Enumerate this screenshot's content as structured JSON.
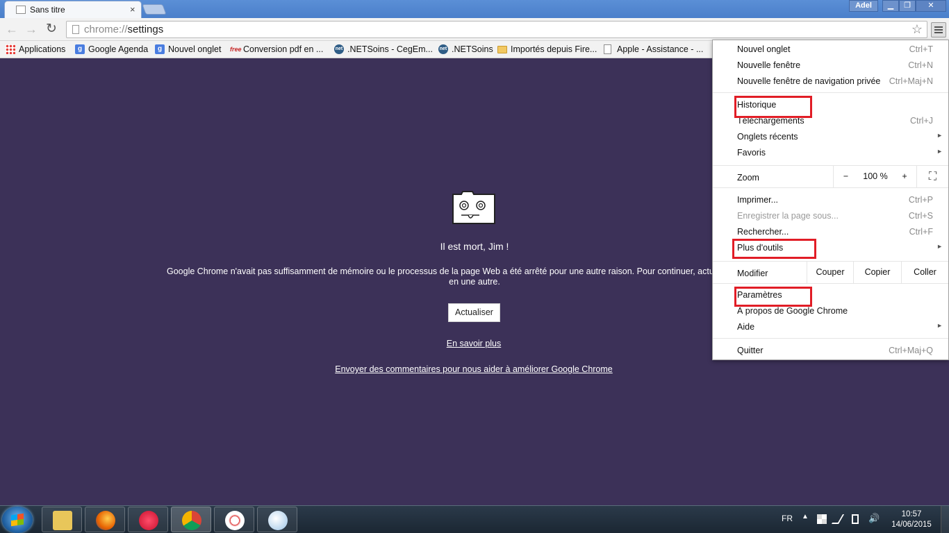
{
  "window": {
    "tab_title": "Sans titre",
    "tab_close": "×",
    "user": "Adel",
    "min": "▁",
    "max": "❐",
    "close": "✕"
  },
  "toolbar": {
    "back": "←",
    "forward": "→",
    "reload": "↻",
    "url_scheme": "chrome://",
    "url_host": "settings",
    "star": "☆"
  },
  "bookmarks": [
    {
      "label": "Applications",
      "icon": "apps-grid-icon"
    },
    {
      "label": "Google Agenda",
      "icon": "google-icon"
    },
    {
      "label": "Nouvel onglet",
      "icon": "google-icon"
    },
    {
      "label": "Conversion pdf en ...",
      "icon": "free-icon"
    },
    {
      "label": ".NETSoins - CegEm...",
      "icon": "net-icon"
    },
    {
      "label": ".NETSoins",
      "icon": "net-icon"
    },
    {
      "label": "Importés depuis Fire...",
      "icon": "folder-icon"
    },
    {
      "label": "Apple - Assistance - ...",
      "icon": "page-icon"
    }
  ],
  "page": {
    "title": "Il est mort, Jim !",
    "message": "Google Chrome n'avait pas suffisamment de mémoire ou le processus de la page Web a été arrêté pour une autre raison. Pour continuer, actualisez la page ou ouvrez-la en une autre.",
    "message_line1": "Google Chrome n'avait pas suffisamment de mémoire ou le processus de la page Web a été arrêté pour une autre raison. Pour continuer, actualisez la page ou ouvrez-la",
    "message_line2": "en une autre.",
    "reload_button": "Actualiser",
    "learn_more": "En savoir plus",
    "feedback": "Envoyer des commentaires pour nous aider à améliorer Google Chrome"
  },
  "menu": {
    "new_tab": {
      "label": "Nouvel onglet",
      "shortcut": "Ctrl+T"
    },
    "new_window": {
      "label": "Nouvelle fenêtre",
      "shortcut": "Ctrl+N"
    },
    "incognito": {
      "label": "Nouvelle fenêtre de navigation privée",
      "shortcut": "Ctrl+Maj+N"
    },
    "history": {
      "label": "Historique"
    },
    "downloads": {
      "label": "Téléchargements",
      "shortcut": "Ctrl+J"
    },
    "recent_tabs": {
      "label": "Onglets récents"
    },
    "bookmarks": {
      "label": "Favoris"
    },
    "zoom": {
      "label": "Zoom",
      "minus": "−",
      "value": "100 %",
      "plus": "+",
      "fullscreen": "⛶"
    },
    "print": {
      "label": "Imprimer...",
      "shortcut": "Ctrl+P"
    },
    "save_page": {
      "label": "Enregistrer la page sous...",
      "shortcut": "Ctrl+S"
    },
    "find": {
      "label": "Rechercher...",
      "shortcut": "Ctrl+F"
    },
    "more_tools": {
      "label": "Plus d'outils"
    },
    "edit": {
      "label": "Modifier",
      "cut": "Couper",
      "copy": "Copier",
      "paste": "Coller"
    },
    "settings": {
      "label": "Paramètres"
    },
    "about": {
      "label": "À propos de Google Chrome"
    },
    "help": {
      "label": "Aide"
    },
    "quit": {
      "label": "Quitter",
      "shortcut": "Ctrl+Maj+Q"
    },
    "arrow": "►"
  },
  "taskbar": {
    "lang": "FR",
    "tray_arrow": "▲",
    "volume": "🔊",
    "time": "10:57",
    "date": "14/06/2015"
  }
}
